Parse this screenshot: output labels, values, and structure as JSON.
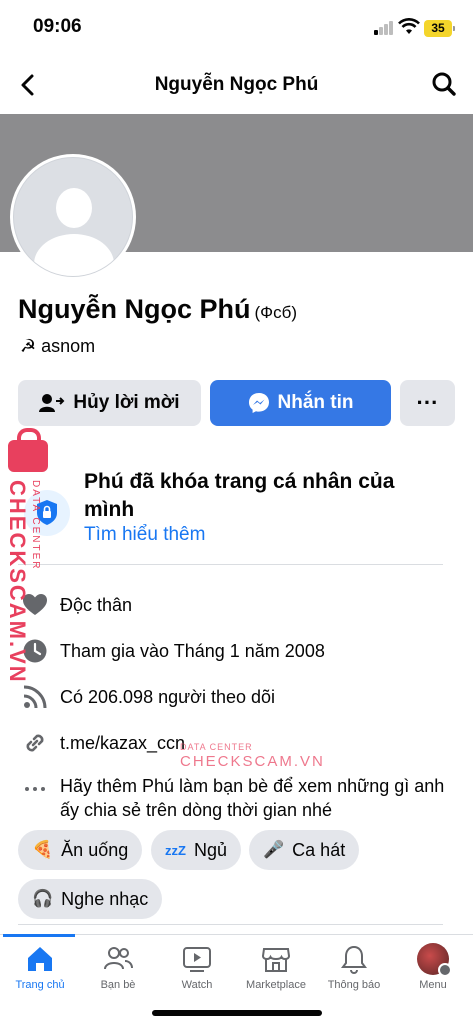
{
  "status_bar": {
    "time": "09:06",
    "battery": "35"
  },
  "nav": {
    "title": "Nguyễn Ngọc Phú"
  },
  "profile": {
    "name": "Nguyễn Ngọc Phú",
    "alt_name": "(Фсб)",
    "subtitle": "☭ asnom"
  },
  "actions": {
    "cancel_request": "Hủy lời mời",
    "message": "Nhắn tin",
    "more": "···"
  },
  "lock_notice": {
    "title": "Phú đã khóa trang cá nhân của mình",
    "link": "Tìm hiểu thêm"
  },
  "details": {
    "relationship": "Độc thân",
    "joined": "Tham gia vào Tháng 1 năm 2008",
    "followers": "Có 206.098 người theo dõi",
    "link": "t.me/kazax_ccn",
    "add_friend_hint": "Hãy thêm Phú làm bạn bè để xem những gì anh ấy chia sẻ trên dòng thời gian nhé"
  },
  "hobbies": [
    {
      "icon": "pizza-icon",
      "emoji": "🍕",
      "label": "Ăn uống"
    },
    {
      "icon": "sleep-icon",
      "emoji": "zzZ",
      "label": "Ngủ"
    },
    {
      "icon": "microphone-icon",
      "emoji": "🎤",
      "label": "Ca hát"
    },
    {
      "icon": "headphones-icon",
      "emoji": "🎧",
      "label": "Nghe nhạc"
    }
  ],
  "tab_bar": {
    "home": "Trang chủ",
    "friends": "Bạn bè",
    "watch": "Watch",
    "marketplace": "Marketplace",
    "notifications": "Thông báo",
    "menu": "Menu"
  },
  "watermark": {
    "vertical": "CHECKSCAM.VN",
    "vertical_small": "DATA CENTER",
    "mid_small": "DATA CENTER",
    "mid": "CHECKSCAM.VN"
  },
  "colors": {
    "accent": "#1877f2",
    "button_blue": "#3578e5",
    "watermark": "#e8405e"
  }
}
